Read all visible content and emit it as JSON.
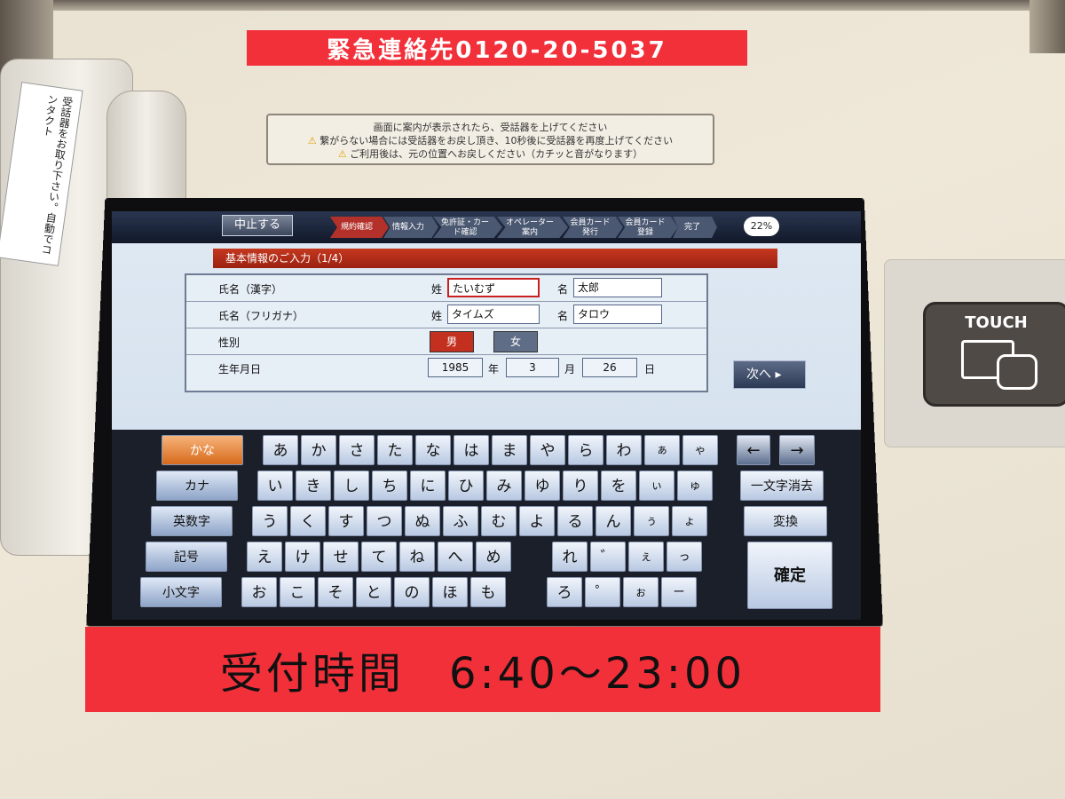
{
  "emergency_contact": "緊急連絡先0120-20-5037",
  "notice": {
    "line1": "画面に案内が表示されたら、受話器を上げてください",
    "line2": "繋がらない場合には受話器をお戻し頂き、10秒後に受話器を再度上げてください",
    "line3": "ご利用後は、元の位置へお戻しください（カチッと音がなります）"
  },
  "phone_label": "受話器をお取り下さい。自動でコンタクト",
  "touch_label": "TOUCH",
  "screen": {
    "cancel_label": "中止する",
    "steps": [
      "規約確認",
      "情報入力",
      "免許証・カード確認",
      "オペレーター案内",
      "会員カード発行",
      "会員カード登録",
      "完了"
    ],
    "progress": "22%",
    "section_title": "基本情報のご入力（1/4）",
    "form": {
      "name_kanji_label": "氏名（漢字）",
      "name_kana_label": "氏名（フリガナ）",
      "gender_label": "性別",
      "birthdate_label": "生年月日",
      "surname_label": "姓",
      "given_label": "名",
      "surname_kanji": "たいむず",
      "given_kanji": "太郎",
      "surname_kana": "タイムズ",
      "given_kana": "タロウ",
      "male_label": "男",
      "female_label": "女",
      "year": "1985",
      "year_unit": "年",
      "month": "3",
      "month_unit": "月",
      "day": "26",
      "day_unit": "日"
    },
    "next_label": "次へ ▸",
    "keyboard": {
      "modes": [
        "かな",
        "カナ",
        "英数字",
        "記号",
        "小文字"
      ],
      "row1": [
        "あ",
        "か",
        "さ",
        "た",
        "な",
        "は",
        "ま",
        "や",
        "ら",
        "わ",
        "ぁ",
        "ゃ"
      ],
      "row2": [
        "い",
        "き",
        "し",
        "ち",
        "に",
        "ひ",
        "み",
        "ゆ",
        "り",
        "を",
        "ぃ",
        "ゅ"
      ],
      "row3": [
        "う",
        "く",
        "す",
        "つ",
        "ぬ",
        "ふ",
        "む",
        "よ",
        "る",
        "ん",
        "ぅ",
        "ょ"
      ],
      "row4": [
        "え",
        "け",
        "せ",
        "て",
        "ね",
        "へ",
        "め",
        "",
        "れ",
        "゛",
        "ぇ",
        "っ"
      ],
      "row5": [
        "お",
        "こ",
        "そ",
        "と",
        "の",
        "ほ",
        "も",
        "",
        "ろ",
        "゜",
        "ぉ",
        "ー"
      ],
      "arrow_left": "←",
      "arrow_right": "→",
      "delete_label": "一文字消去",
      "convert_label": "変換",
      "confirm_label": "確定"
    }
  },
  "hours": {
    "label": "受付時間",
    "time": "6:40～23:00"
  }
}
